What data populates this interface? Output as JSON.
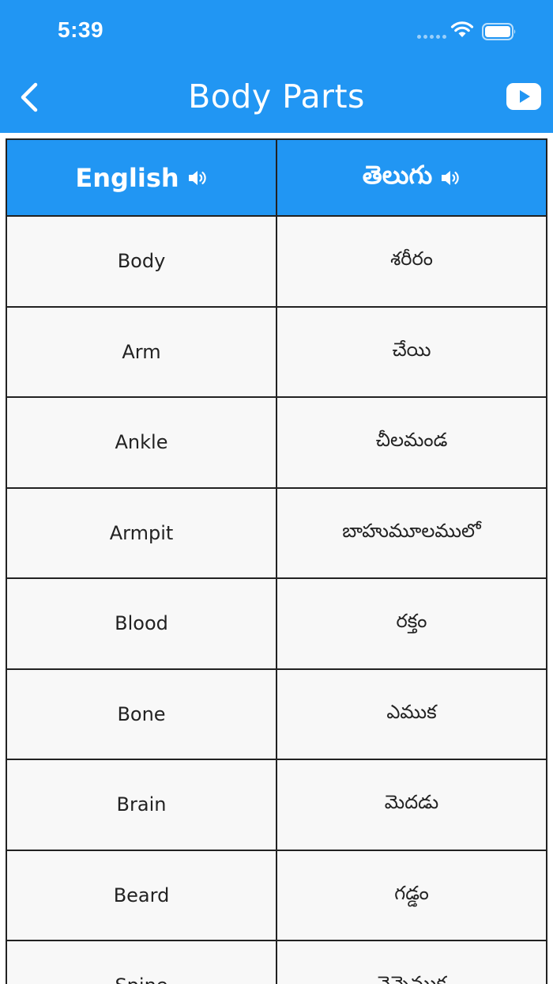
{
  "status_bar": {
    "time": "5:39"
  },
  "header": {
    "title": "Body Parts",
    "back_icon": "chevron-left-icon",
    "video_icon": "youtube-play-icon"
  },
  "colors": {
    "primary": "#2196F3",
    "row_bg": "#f8f8f8",
    "border": "#222222",
    "text": "#222222"
  },
  "table": {
    "columns": [
      {
        "label": "English",
        "icon": "speaker-icon"
      },
      {
        "label": "తెలుగు",
        "icon": "speaker-icon"
      }
    ],
    "rows": [
      {
        "english": "Body",
        "telugu": "శరీరం"
      },
      {
        "english": "Arm",
        "telugu": "చేయి"
      },
      {
        "english": "Ankle",
        "telugu": "చీలమండ"
      },
      {
        "english": "Armpit",
        "telugu": "బాహుమూలములో"
      },
      {
        "english": "Blood",
        "telugu": "రక్తం"
      },
      {
        "english": "Bone",
        "telugu": "ఎముక"
      },
      {
        "english": "Brain",
        "telugu": "మెదడు"
      },
      {
        "english": "Beard",
        "telugu": "గడ్డం"
      },
      {
        "english": "Spine",
        "telugu": "వెన్నెముక"
      }
    ]
  }
}
